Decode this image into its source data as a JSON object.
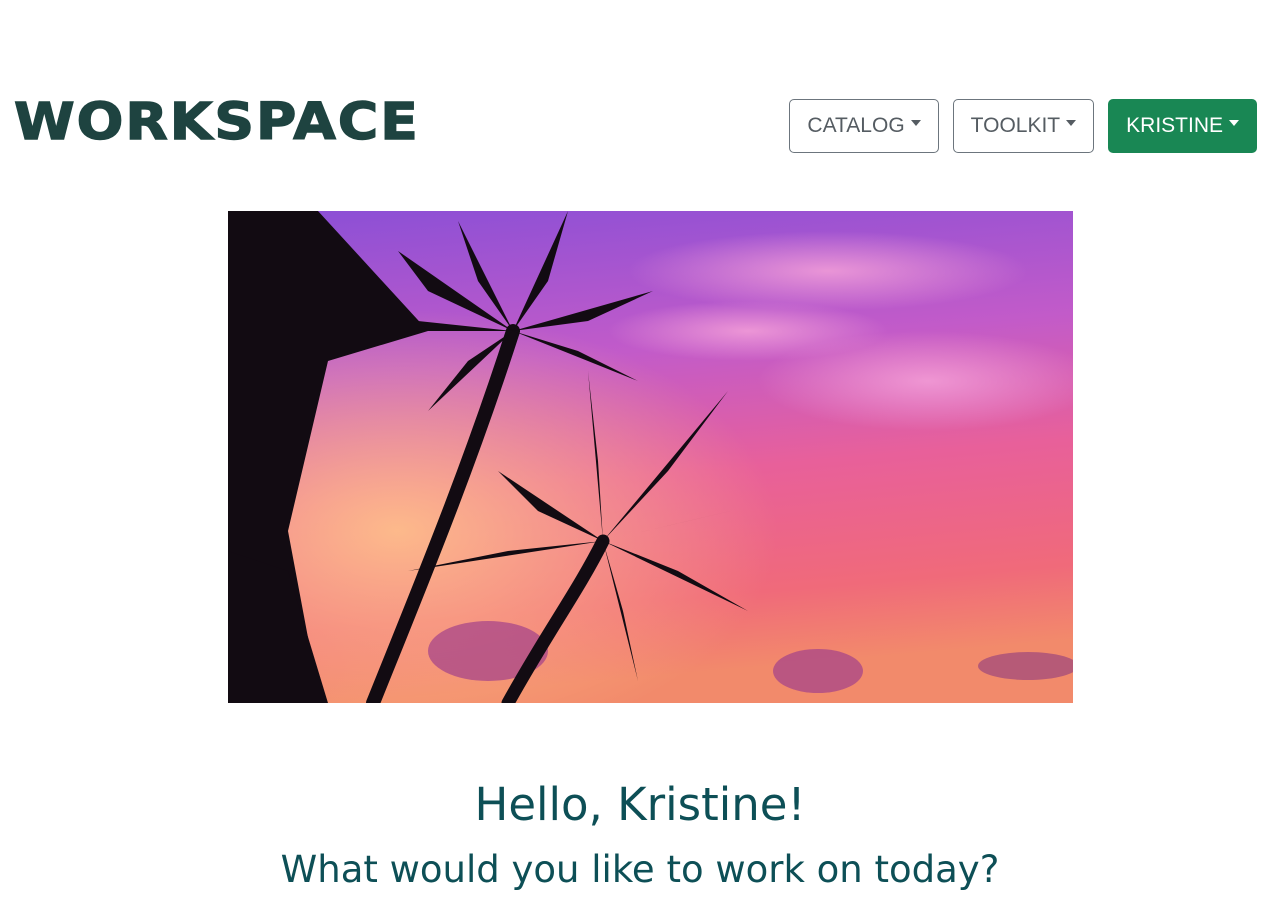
{
  "header": {
    "logo_text": "WORKSPACE",
    "nav": {
      "catalog_label": "CATALOG",
      "toolkit_label": "TOOLKIT",
      "user_label": "KRISTINE"
    }
  },
  "hero": {
    "image": "palm-trees-sunset-photo"
  },
  "greeting": {
    "title": "Hello, Kristine!",
    "subtitle": "What would you like to work on today?"
  },
  "colors": {
    "logo": "#1e4340",
    "primary_button": "#198754",
    "greeting_text": "#0d4f56"
  }
}
